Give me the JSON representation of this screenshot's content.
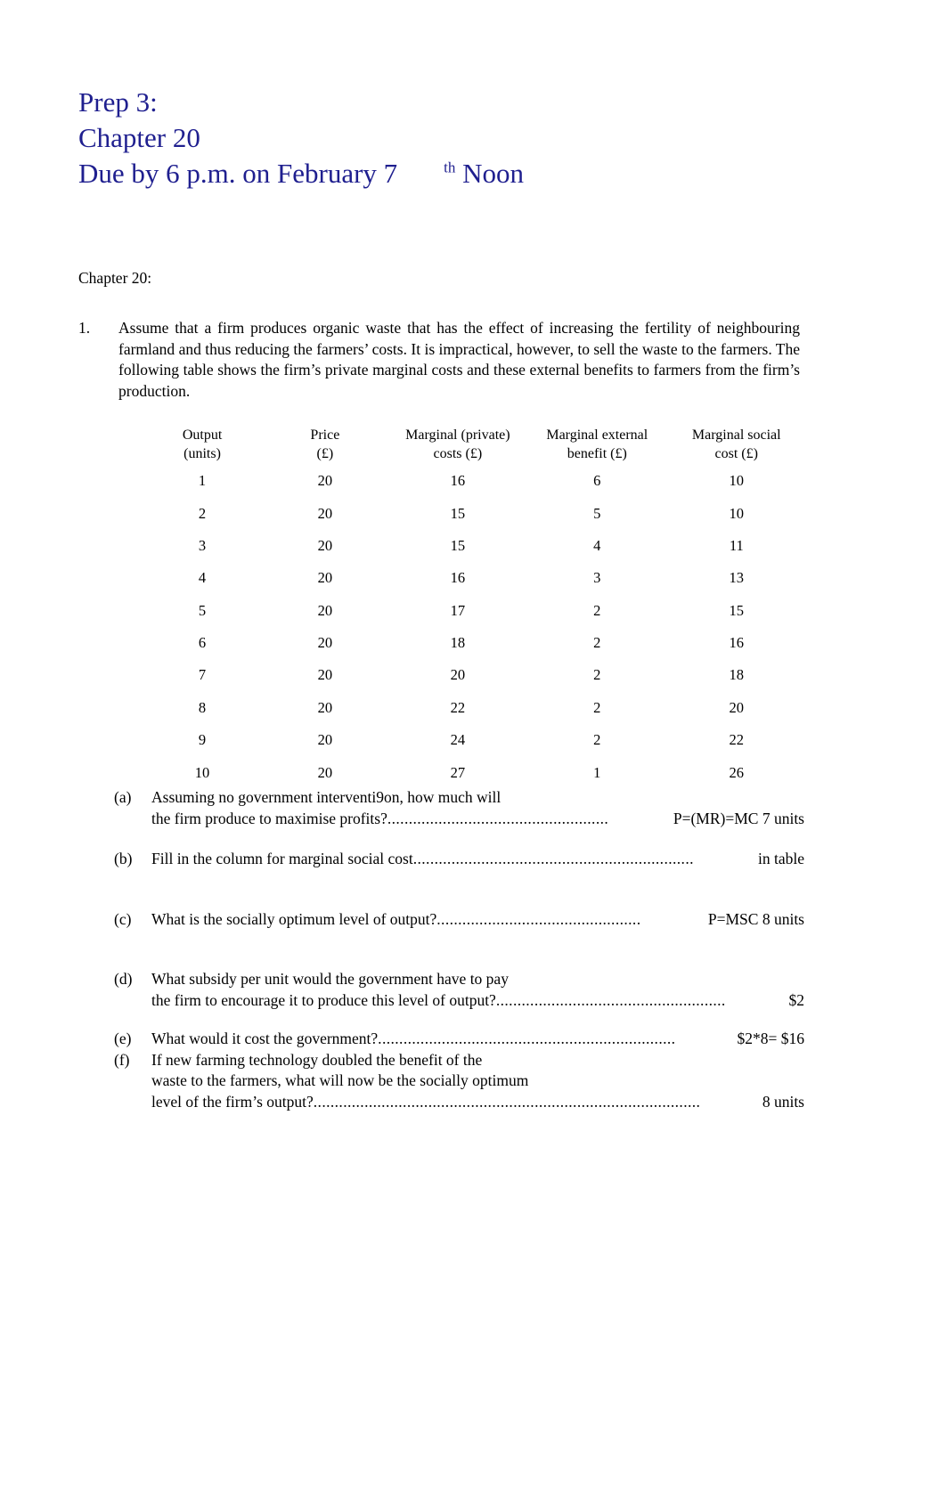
{
  "title": {
    "line1": "Prep 3:",
    "line2": "Chapter 20",
    "line3_main": "Due by 6 p.m. on February 7",
    "line3_sup": "th",
    "line3_tail": "Noon",
    "color": "#1f1f8f"
  },
  "chapter_label": "Chapter 20:",
  "question1": {
    "number": "1.",
    "text": "Assume that a firm produces organic waste that has the effect of increasing the fertility of neighbouring farmland and thus reducing the farmers’ costs. It is impractical, however, to sell the waste to the farmers. The following table shows the firm’s private marginal costs and these external benefits to farmers from the firm’s production."
  },
  "table": {
    "headers": [
      {
        "line1": "Output",
        "line2": "(units)"
      },
      {
        "line1": "Price",
        "line2": "(£)"
      },
      {
        "line1": "Marginal (private)",
        "line2": "costs (£)"
      },
      {
        "line1": "Marginal external",
        "line2": "benefit (£)"
      },
      {
        "line1": "Marginal social",
        "line2": "cost (£)"
      }
    ],
    "rows": [
      [
        "1",
        "20",
        "16",
        "6",
        "10"
      ],
      [
        "2",
        "20",
        "15",
        "5",
        "10"
      ],
      [
        "3",
        "20",
        "15",
        "4",
        "11"
      ],
      [
        "4",
        "20",
        "16",
        "3",
        "13"
      ],
      [
        "5",
        "20",
        "17",
        "2",
        "15"
      ],
      [
        "6",
        "20",
        "18",
        "2",
        "16"
      ],
      [
        "7",
        "20",
        "20",
        "2",
        "18"
      ],
      [
        "8",
        "20",
        "22",
        "2",
        "20"
      ],
      [
        "9",
        "20",
        "24",
        "2",
        "22"
      ],
      [
        "10",
        "20",
        "27",
        "1",
        "26"
      ]
    ]
  },
  "questions": [
    {
      "letter": "(a)",
      "line1": "Assuming no government interventi9on, how much will",
      "lead": "the firm produce to maximise profits?",
      "dots": "....................................................",
      "answer": "P=(MR)=MC 7 units"
    },
    {
      "letter": "(b)",
      "line1": "",
      "lead": "Fill in the column for marginal social cost",
      "dots": "..................................................................",
      "answer": "in table"
    },
    {
      "letter": "(c)",
      "line1": "",
      "lead": "What is the socially optimum level of output?",
      "dots": "................................................",
      "answer": "P=MSC 8 units"
    },
    {
      "letter": "(d)",
      "line1": "What subsidy per unit would the government have to pay",
      "lead": "the firm to encourage it to produce this level of output?",
      "dots": "......................................................",
      "answer": "$2"
    },
    {
      "letter": "(e)",
      "line1": "",
      "lead": "What would it cost the government?",
      "dots": "......................................................................",
      "answer": "$2*8= $16"
    },
    {
      "letter": "(f)",
      "line1": "If new farming technology doubled the benefit of the",
      "line2": "waste to the farmers, what will now be the socially optimum",
      "lead": "level of the firm’s output?",
      "dots": "...........................................................................................",
      "answer": "8 units"
    }
  ]
}
